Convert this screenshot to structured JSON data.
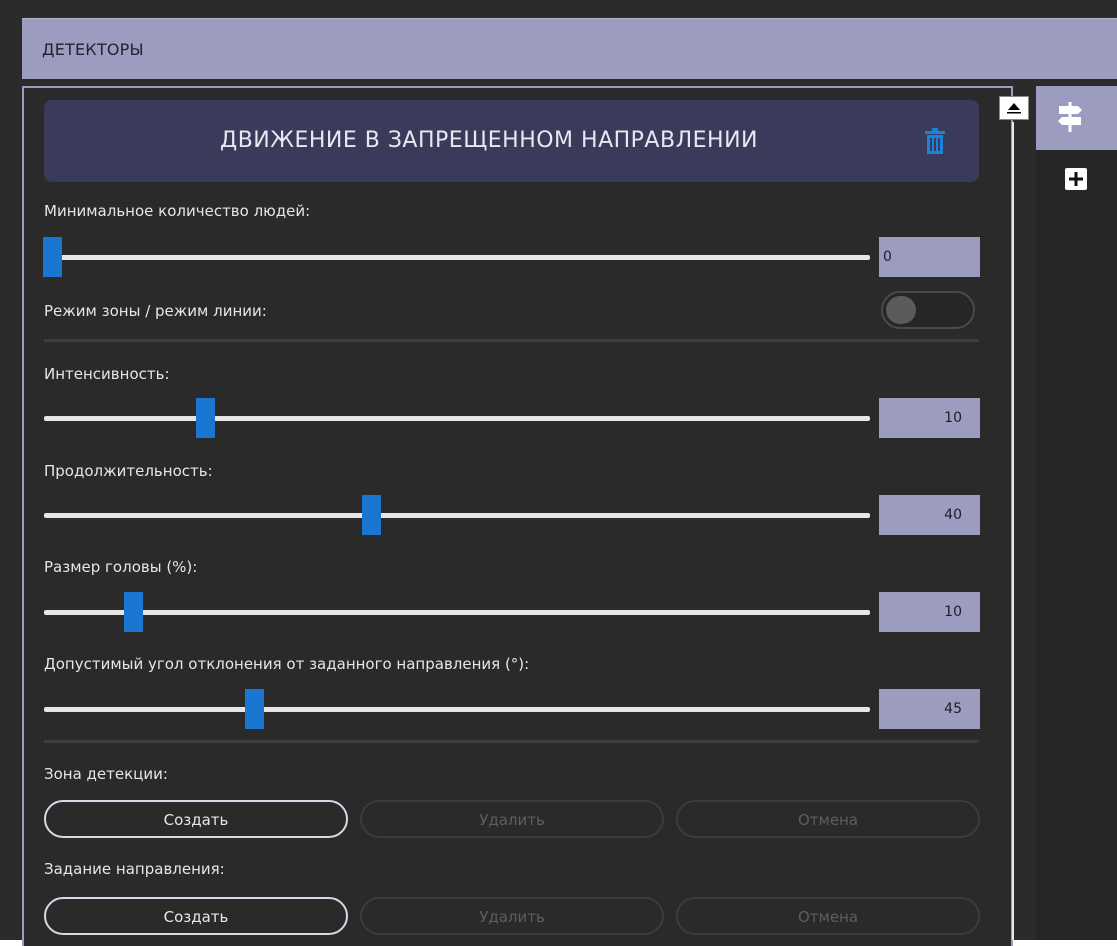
{
  "header": {
    "title": "ДЕТЕКТОРЫ"
  },
  "detector": {
    "title": "ДВИЖЕНИЕ В ЗАПРЕЩЕННОМ НАПРАВЛЕНИИ"
  },
  "settings": {
    "min_people": {
      "label": "Минимальное количество людей:",
      "value": "0",
      "position": 0.0
    },
    "zone_line_mode": {
      "label": "Режим зоны / режим линии:",
      "enabled": false
    },
    "intensity": {
      "label": "Интенсивность:",
      "value": "10",
      "position": 0.19
    },
    "duration": {
      "label": "Продолжительность:",
      "value": "40",
      "position": 0.395
    },
    "head_size": {
      "label": "Размер головы (%):",
      "value": "10",
      "position": 0.1
    },
    "deviation_angle": {
      "label": "Допустимый угол отклонения от заданного направления (°):",
      "value": "45",
      "position": 0.25
    }
  },
  "detection_zone": {
    "label": "Зона детекции:",
    "create": "Создать",
    "delete": "Удалить",
    "cancel": "Отмена"
  },
  "direction": {
    "label": "Задание направления:",
    "create": "Создать",
    "delete": "Удалить",
    "cancel": "Отмена"
  },
  "colors": {
    "accent": "#9c9cc0",
    "slider_thumb": "#1b76d2",
    "title_box": "#3a3a5a",
    "background": "#2b2b2b"
  },
  "icons": {
    "delete": "trash-icon",
    "detector_tab": "signpost-icon",
    "add": "plus-icon"
  }
}
